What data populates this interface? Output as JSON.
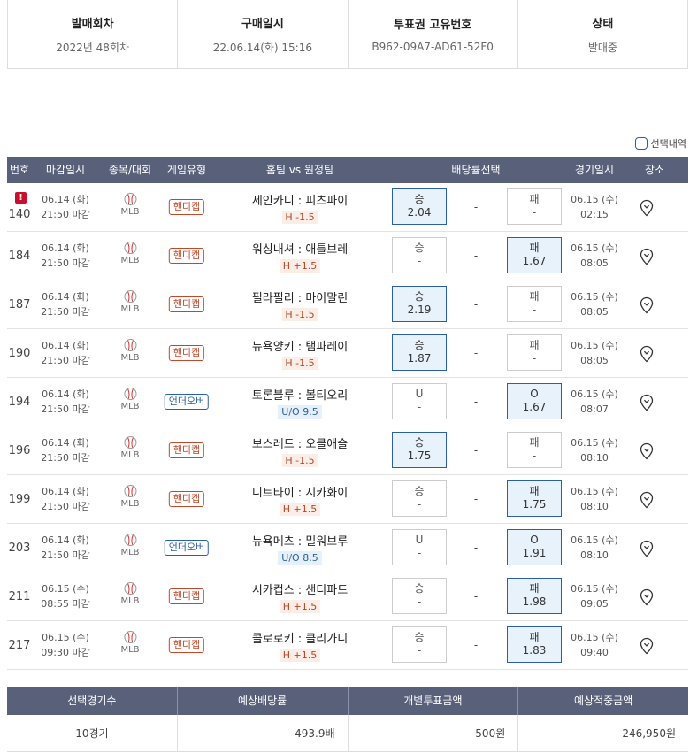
{
  "info": {
    "round_label": "발매회차",
    "round_value": "2022년 48회차",
    "purchase_label": "구매일시",
    "purchase_value": "22.06.14(화) 15:16",
    "ticket_label": "투표권 고유번호",
    "ticket_value": "B962-09A7-AD61-52F0",
    "status_label": "상태",
    "status_value": "발매중"
  },
  "legend": {
    "label": "선택내역"
  },
  "header": {
    "no": "번호",
    "deadline": "마감일시",
    "sport": "종목/대회",
    "type": "게임유형",
    "teams": "홈팀 vs 원정팀",
    "odds": "배당률선택",
    "game_date": "경기일시",
    "venue": "장소"
  },
  "games": [
    {
      "no": "140",
      "warn": "!",
      "d1": "06.14 (화)",
      "d2": "21:50 마감",
      "sport": "MLB",
      "type": "핸디캡",
      "tclass": "h",
      "teams": "세인카디 : 피츠파이",
      "line": "H -1.5",
      "left_label": "승",
      "left_val": "2.04",
      "left_sel": true,
      "draw": "-",
      "right_label": "패",
      "right_val": "-",
      "right_sel": false,
      "g1": "06.15 (수)",
      "g2": "02:15"
    },
    {
      "no": "184",
      "warn": "",
      "d1": "06.14 (화)",
      "d2": "21:50 마감",
      "sport": "MLB",
      "type": "핸디캡",
      "tclass": "h",
      "teams": "워싱내셔 : 애틀브레",
      "line": "H +1.5",
      "left_label": "승",
      "left_val": "-",
      "left_sel": false,
      "draw": "-",
      "right_label": "패",
      "right_val": "1.67",
      "right_sel": true,
      "g1": "06.15 (수)",
      "g2": "08:05"
    },
    {
      "no": "187",
      "warn": "",
      "d1": "06.14 (화)",
      "d2": "21:50 마감",
      "sport": "MLB",
      "type": "핸디캡",
      "tclass": "h",
      "teams": "필라필리 : 마이말린",
      "line": "H -1.5",
      "left_label": "승",
      "left_val": "2.19",
      "left_sel": true,
      "draw": "-",
      "right_label": "패",
      "right_val": "-",
      "right_sel": false,
      "g1": "06.15 (수)",
      "g2": "08:05"
    },
    {
      "no": "190",
      "warn": "",
      "d1": "06.14 (화)",
      "d2": "21:50 마감",
      "sport": "MLB",
      "type": "핸디캡",
      "tclass": "h",
      "teams": "뉴욕양키 : 탬파레이",
      "line": "H -1.5",
      "left_label": "승",
      "left_val": "1.87",
      "left_sel": true,
      "draw": "-",
      "right_label": "패",
      "right_val": "-",
      "right_sel": false,
      "g1": "06.15 (수)",
      "g2": "08:05"
    },
    {
      "no": "194",
      "warn": "",
      "d1": "06.14 (화)",
      "d2": "21:50 마감",
      "sport": "MLB",
      "type": "언더오버",
      "tclass": "uo",
      "teams": "토론블루 : 볼티오리",
      "line": "U/O 9.5",
      "left_label": "U",
      "left_val": "-",
      "left_sel": false,
      "draw": "-",
      "right_label": "O",
      "right_val": "1.67",
      "right_sel": true,
      "g1": "06.15 (수)",
      "g2": "08:07"
    },
    {
      "no": "196",
      "warn": "",
      "d1": "06.14 (화)",
      "d2": "21:50 마감",
      "sport": "MLB",
      "type": "핸디캡",
      "tclass": "h",
      "teams": "보스레드 : 오클애슬",
      "line": "H -1.5",
      "left_label": "승",
      "left_val": "1.75",
      "left_sel": true,
      "draw": "-",
      "right_label": "패",
      "right_val": "-",
      "right_sel": false,
      "g1": "06.15 (수)",
      "g2": "08:10"
    },
    {
      "no": "199",
      "warn": "",
      "d1": "06.14 (화)",
      "d2": "21:50 마감",
      "sport": "MLB",
      "type": "핸디캡",
      "tclass": "h",
      "teams": "디트타이 : 시카화이",
      "line": "H +1.5",
      "left_label": "승",
      "left_val": "-",
      "left_sel": false,
      "draw": "-",
      "right_label": "패",
      "right_val": "1.75",
      "right_sel": true,
      "g1": "06.15 (수)",
      "g2": "08:10"
    },
    {
      "no": "203",
      "warn": "",
      "d1": "06.14 (화)",
      "d2": "21:50 마감",
      "sport": "MLB",
      "type": "언더오버",
      "tclass": "uo",
      "teams": "뉴욕메츠 : 밀워브루",
      "line": "U/O 8.5",
      "left_label": "U",
      "left_val": "-",
      "left_sel": false,
      "draw": "-",
      "right_label": "O",
      "right_val": "1.91",
      "right_sel": true,
      "g1": "06.15 (수)",
      "g2": "08:10"
    },
    {
      "no": "211",
      "warn": "",
      "d1": "06.15 (수)",
      "d2": "08:55 마감",
      "sport": "MLB",
      "type": "핸디캡",
      "tclass": "h",
      "teams": "시카컵스 : 샌디파드",
      "line": "H +1.5",
      "left_label": "승",
      "left_val": "-",
      "left_sel": false,
      "draw": "-",
      "right_label": "패",
      "right_val": "1.98",
      "right_sel": true,
      "g1": "06.15 (수)",
      "g2": "09:05"
    },
    {
      "no": "217",
      "warn": "",
      "d1": "06.15 (수)",
      "d2": "09:30 마감",
      "sport": "MLB",
      "type": "핸디캡",
      "tclass": "h",
      "teams": "콜로로키 : 클리가디",
      "line": "H +1.5",
      "left_label": "승",
      "left_val": "-",
      "left_sel": false,
      "draw": "-",
      "right_label": "패",
      "right_val": "1.83",
      "right_sel": true,
      "g1": "06.15 (수)",
      "g2": "09:40"
    }
  ],
  "summary": {
    "h_count": "선택경기수",
    "h_odds": "예상배당률",
    "h_amount": "개별투표금액",
    "h_total": "예상적중금액",
    "count": "10경기",
    "odds": "493.9배",
    "amount": "500원",
    "total": "246,950원"
  }
}
